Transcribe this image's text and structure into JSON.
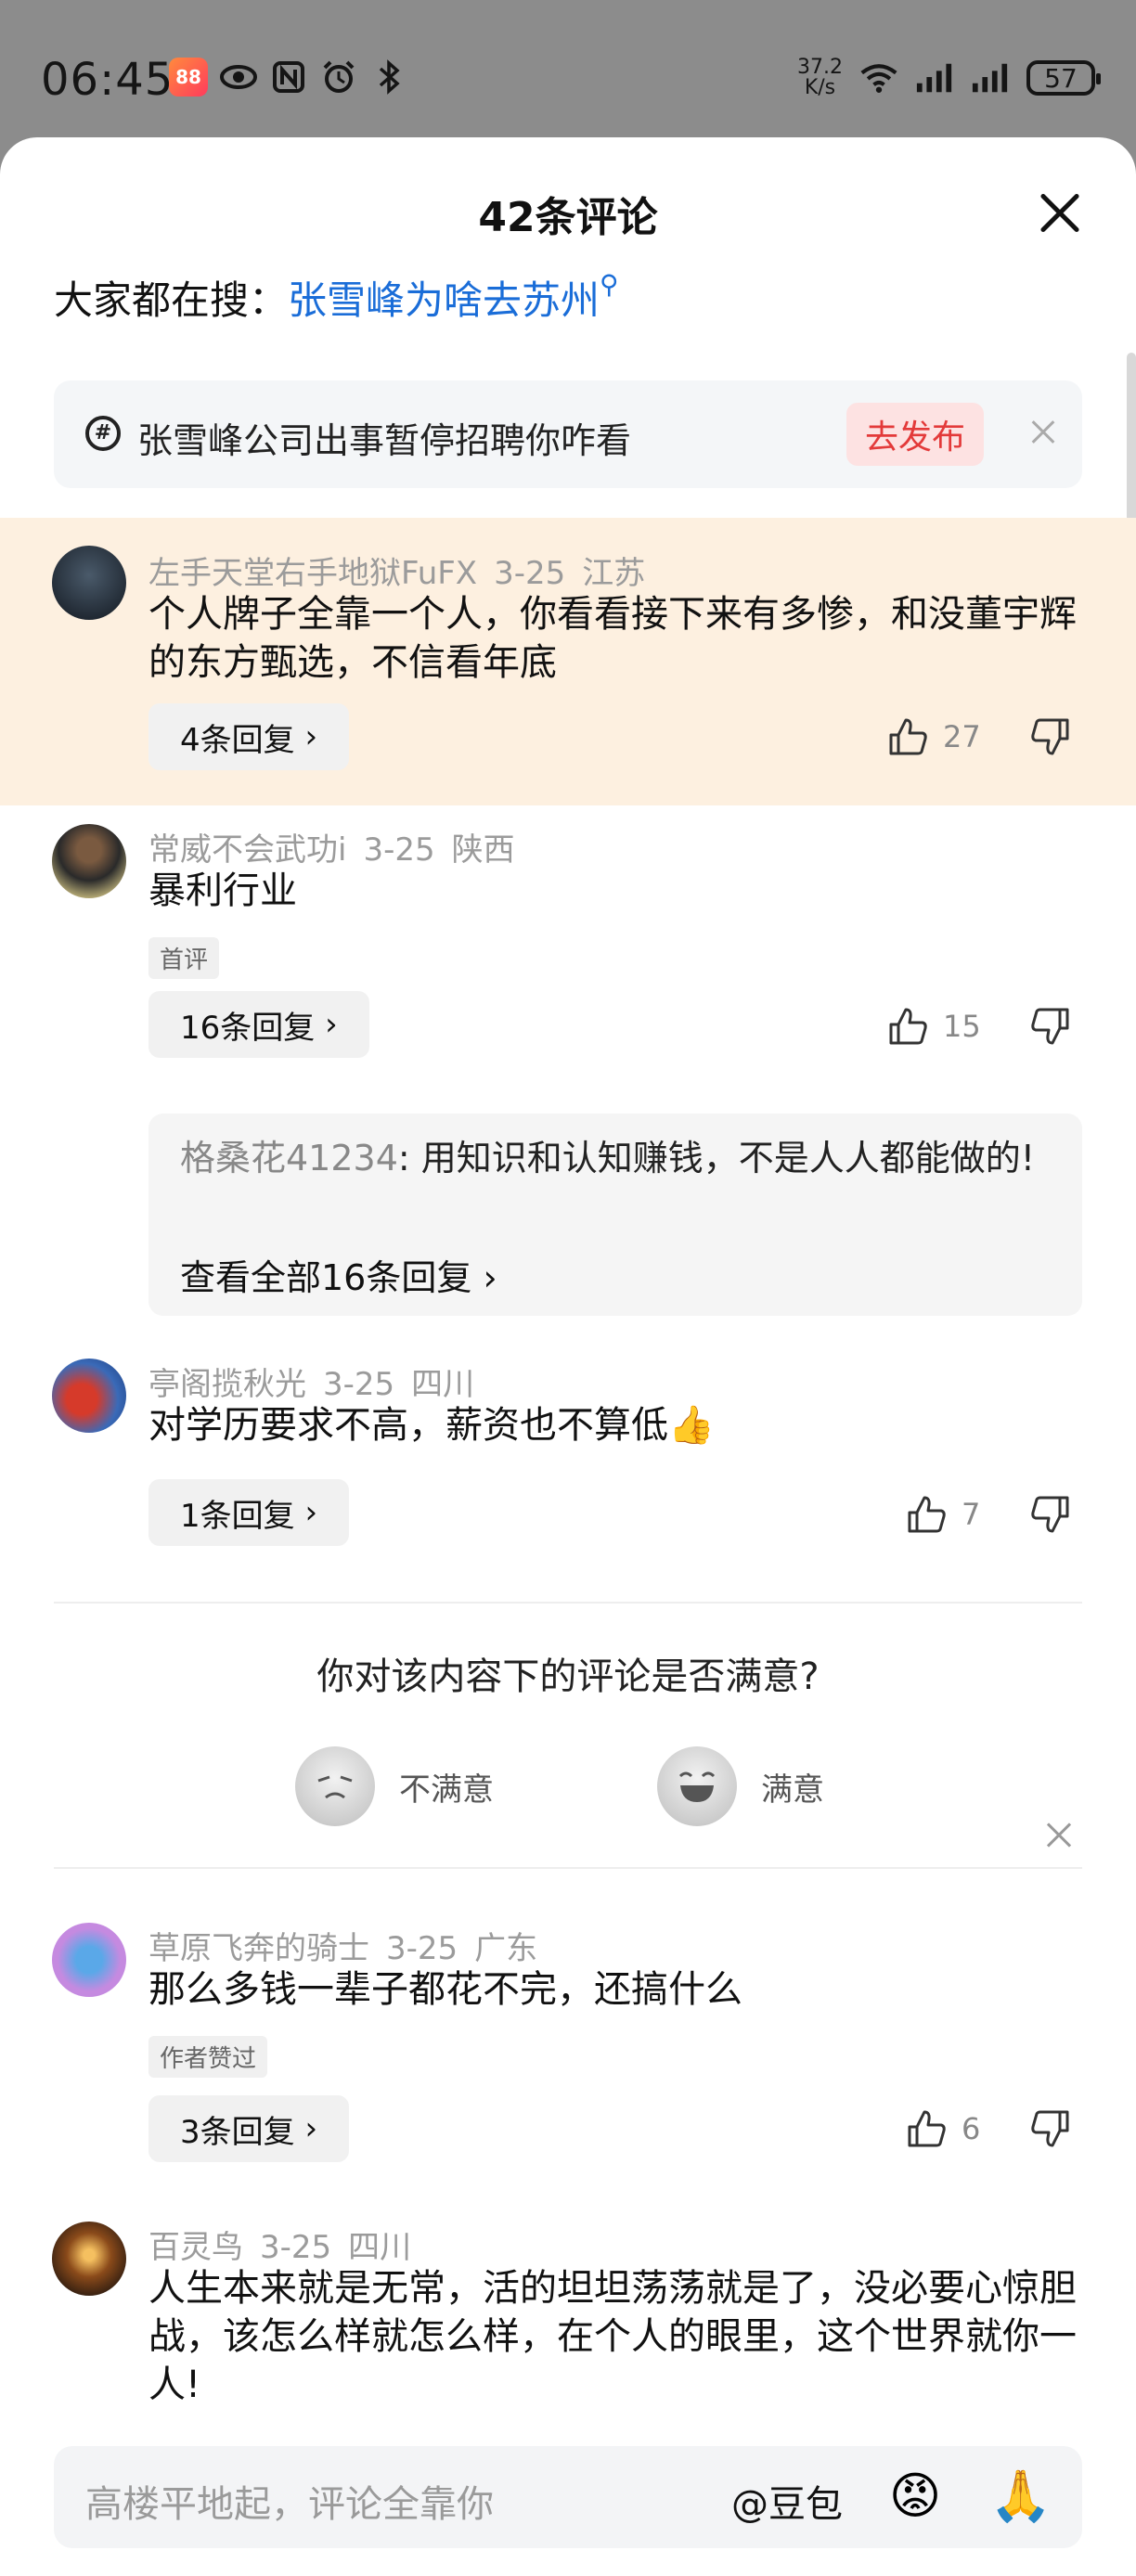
{
  "status_bar": {
    "time": "06:45",
    "speed_top": "37.2",
    "speed_bottom": "K/s",
    "battery": "57"
  },
  "sheet": {
    "title": "42条评论"
  },
  "search": {
    "prefix": "大家都在搜：",
    "keyword": "张雪峰为啥去苏州"
  },
  "promo": {
    "text": "张雪峰公司出事暂停招聘你咋看",
    "button": "去发布"
  },
  "comments": [
    {
      "user": "左手天堂右手地狱FuFX",
      "date": "3-25",
      "location": "江苏",
      "text": "个人牌子全靠一个人，你看看接下来有多惨，和没董宇辉的东方甄选，不信看年底",
      "replies": "4条回复",
      "likes": "27"
    },
    {
      "user": "常威不会武功i",
      "date": "3-25",
      "location": "陕西",
      "text": "暴利行业",
      "tag": "首评",
      "replies": "16条回复",
      "likes": "15",
      "sub_reply": {
        "name": "格桑花41234",
        "text": ": 用知识和认知赚钱，不是人人都能做的!",
        "more": "查看全部16条回复"
      }
    },
    {
      "user": "亭阁揽秋光",
      "date": "3-25",
      "location": "四川",
      "text": "对学历要求不高，薪资也不算低",
      "emoji": "👍",
      "replies": "1条回复",
      "likes": "7"
    },
    {
      "user": "草原飞奔的骑士",
      "date": "3-25",
      "location": "广东",
      "text": "那么多钱一辈子都花不完，还搞什么",
      "tag": "作者赞过",
      "replies": "3条回复",
      "likes": "6"
    },
    {
      "user": "百灵鸟",
      "date": "3-25",
      "location": "四川",
      "text": "人生本来就是无常，活的坦坦荡荡就是了，没必要心惊胆战，该怎么样就怎么样，在个人的眼里，这个世界就你一人!"
    }
  ],
  "survey": {
    "question": "你对该内容下的评论是否满意?",
    "negative": "不满意",
    "positive": "满意"
  },
  "input": {
    "placeholder": "高楼平地起，评论全靠你",
    "at_label": "@豆包"
  },
  "colors": {
    "accent_link": "#1a6dd8",
    "highlight_bg": "#fdf0e0",
    "publish_red": "#e33a3a"
  }
}
